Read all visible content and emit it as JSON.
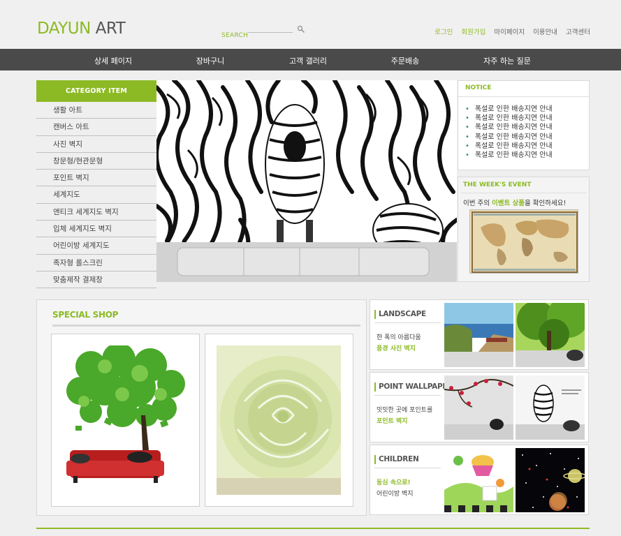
{
  "header": {
    "logo_brand": "DAYUN",
    "logo_rest": "ART",
    "search_label": "SEARCH",
    "links": [
      "로그인",
      "회원가입",
      "마이페이지",
      "이용안내",
      "고객센터"
    ]
  },
  "nav": {
    "items": [
      "상세 페이지",
      "장바구니",
      "고객 갤러리",
      "주문배송",
      "자주 하는 질문"
    ]
  },
  "category": {
    "title": "CATEGORY ITEM",
    "items": [
      "생활 아트",
      "캔버스 아트",
      "사진 벽지",
      "창문형/현관문형",
      "포인트 벽지",
      "세계지도",
      "앤티크 세계지도 벽지",
      "입체 세계지도 벽지",
      "어린이방 세계지도",
      "족자형 롤스크린",
      "맞춤제작 결제창"
    ]
  },
  "notice": {
    "title": "NOTICE",
    "items": [
      "폭설로 인한 배송지연 안내",
      "폭설로 인한 배송지연 안내",
      "폭설로 인한 배송지연 안내",
      "폭설로 인한 배송지연 안내",
      "폭설로 인한 배송지연 안내",
      "폭설로 인한 배송지연 안내"
    ]
  },
  "event": {
    "title": "THE WEEK'S EVENT",
    "desc_pre": "이번 주의 ",
    "desc_highlight": "이벤트 상품",
    "desc_post": "을 확인하세요!"
  },
  "special": {
    "title": "SPECIAL SHOP"
  },
  "rows": [
    {
      "title": "LANDSCAPE",
      "line1": "한 폭의 아름다움",
      "line2": "풍경 사진 벽지",
      "line1_color": "#444",
      "line2_color": "#8cba25"
    },
    {
      "title": "POINT WALLPAPER",
      "line1": "밋밋한 곳에 포인트를",
      "line2": "포인트 벽지",
      "line1_color": "#444",
      "line2_color": "#8cba25"
    },
    {
      "title": "CHILDREN",
      "line1": "동심 속으로!",
      "line2": "어린이방 벽지",
      "line1_color": "#8cba25",
      "line2_color": "#444"
    }
  ],
  "colors": {
    "accent": "#8cba25",
    "nav_bg": "#4b4a4b"
  }
}
